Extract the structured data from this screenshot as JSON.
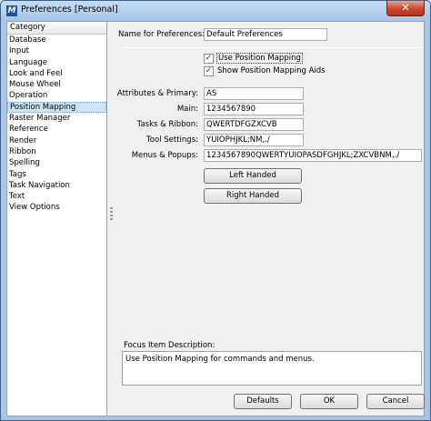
{
  "window": {
    "title": "Preferences [Personal]",
    "close_glyph": "✕",
    "app_icon_glyph": "M"
  },
  "category": {
    "header": "Category",
    "items": [
      "Database",
      "Input",
      "Language",
      "Look and Feel",
      "Mouse Wheel",
      "Operation",
      "Position Mapping",
      "Raster Manager",
      "Reference",
      "Render",
      "Ribbon",
      "Spelling",
      "Tags",
      "Task Navigation",
      "Text",
      "View Options"
    ],
    "selected": "Position Mapping"
  },
  "name_for_preferences": {
    "label": "Name for Preferences:",
    "value": "Default Preferences"
  },
  "checkboxes": {
    "use_position_mapping": {
      "label": "Use Position Mapping",
      "checked": true,
      "glyph": "✓"
    },
    "show_position_mapping_aids": {
      "label": "Show Position Mapping Aids",
      "checked": true,
      "glyph": "✓"
    }
  },
  "mappings": {
    "attributes_primary": {
      "label": "Attributes & Primary:",
      "value": "AS"
    },
    "main": {
      "label": "Main:",
      "value": "1234567890"
    },
    "tasks_ribbon": {
      "label": "Tasks & Ribbon:",
      "value": "QWERTDFGZXCVB"
    },
    "tool_settings": {
      "label": "Tool Settings:",
      "value": "YUIOPHJKL;NM,./"
    },
    "menus_popups": {
      "label": "Menus & Popups:",
      "value": "1234567890QWERTYUIOPASDFGHJKL;ZXCVBNM,./"
    }
  },
  "buttons": {
    "left_handed": "Left Handed",
    "right_handed": "Right Handed",
    "defaults": "Defaults",
    "ok": "OK",
    "cancel": "Cancel"
  },
  "focus_description": {
    "label": "Focus Item Description:",
    "text": "Use Position Mapping for commands and menus."
  },
  "colors": {
    "title_bar": "#a7c4e6",
    "close_button": "#c9452d",
    "selection": "#cde6f7"
  }
}
